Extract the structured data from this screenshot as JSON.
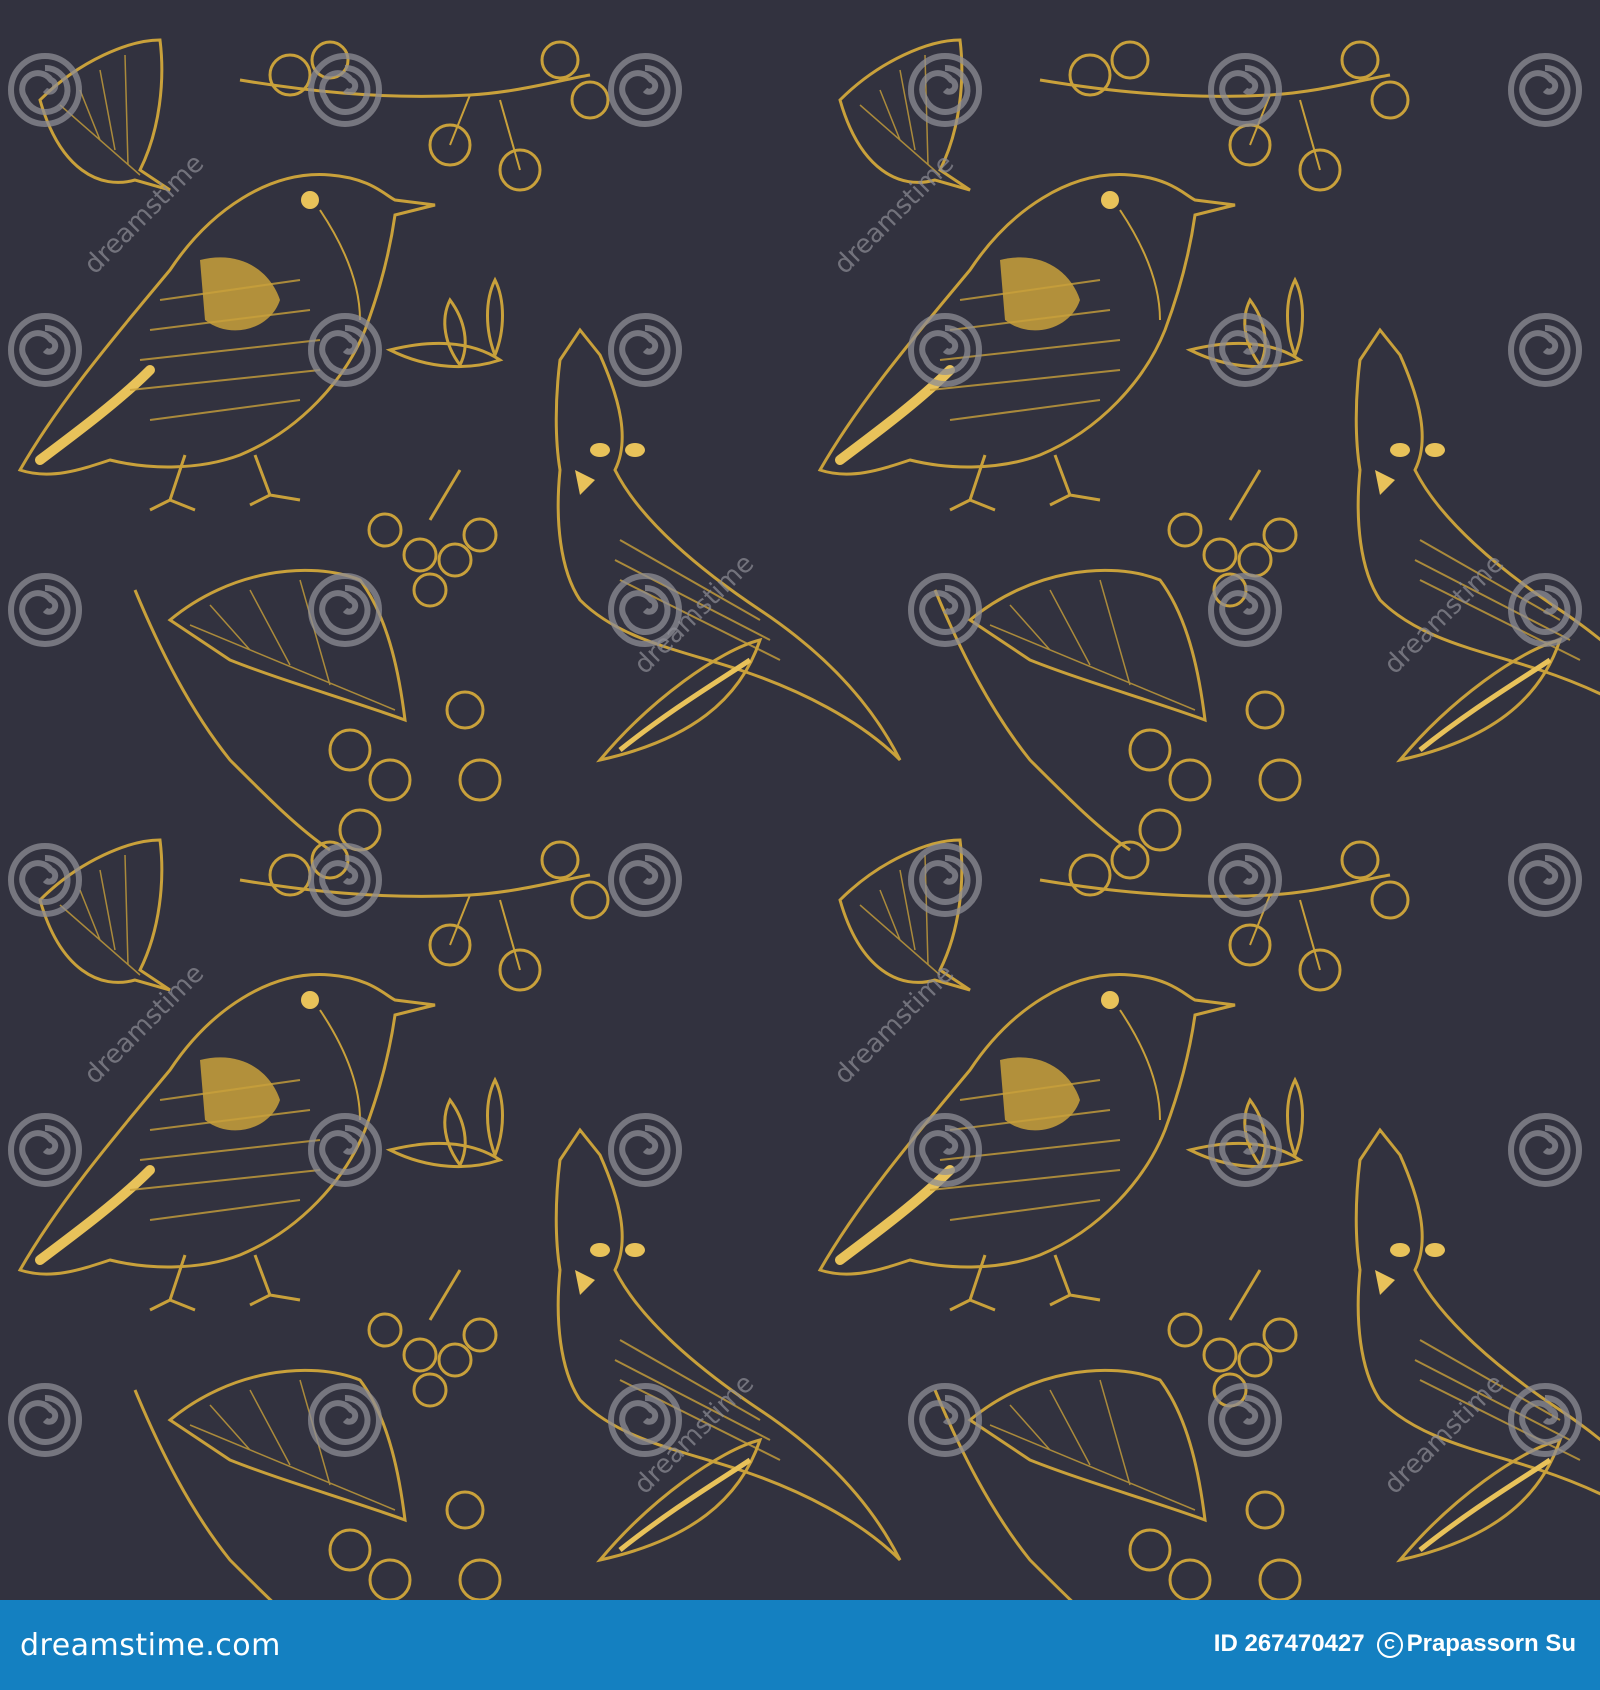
{
  "pattern": {
    "background_color": "#32323f",
    "motif_color": "#c9a13b",
    "motif_highlight_color": "#e8c25a",
    "motifs": [
      "robin-bird",
      "cardinal-bird",
      "berry-branch",
      "leaf"
    ]
  },
  "watermark": {
    "text": "dreamstime",
    "color": "#8e8e96"
  },
  "footer": {
    "background_color": "#1480c1",
    "logo_text": "dreamstime.com",
    "id_label": "ID 267470427",
    "author": "Prapassorn Su"
  }
}
